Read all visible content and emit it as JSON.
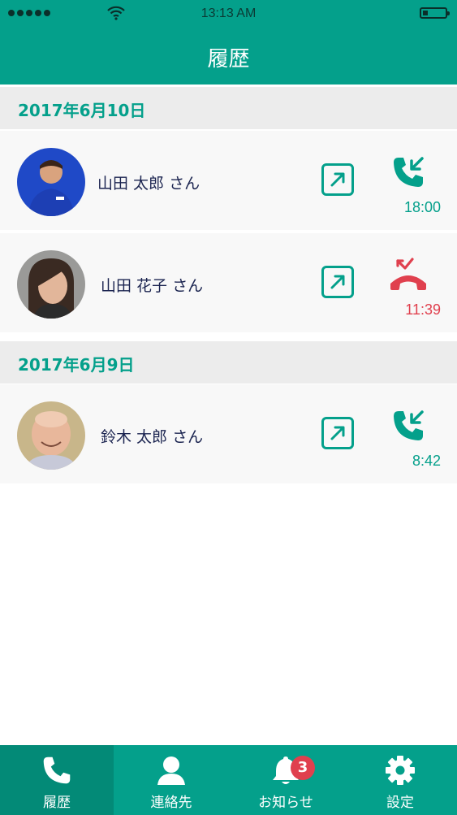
{
  "status_bar": {
    "time": "13:13 AM"
  },
  "header": {
    "title": "履歴"
  },
  "sections": [
    {
      "date": "2017年6月10日",
      "entries": [
        {
          "name": "山田 太郎 さん",
          "time": "18:00",
          "call_type": "incoming",
          "avatar": "man-in-blue-shirt"
        },
        {
          "name": "山田 花子 さん",
          "time": "11:39",
          "call_type": "missed",
          "avatar": "woman-portrait"
        }
      ]
    },
    {
      "date": "2017年6月9日",
      "entries": [
        {
          "name": "鈴木 太郎 さん",
          "time": "8:42",
          "call_type": "incoming",
          "avatar": "bald-man-portrait"
        }
      ]
    }
  ],
  "tabs": [
    {
      "label": "履歴",
      "icon": "phone-icon",
      "active": true
    },
    {
      "label": "連絡先",
      "icon": "person-icon",
      "active": false
    },
    {
      "label": "お知らせ",
      "icon": "bell-icon",
      "active": false,
      "badge": "3"
    },
    {
      "label": "設定",
      "icon": "gear-icon",
      "active": false
    }
  ],
  "colors": {
    "primary": "#04a08b",
    "missed": "#e0404e",
    "section_bg": "#ececec"
  }
}
